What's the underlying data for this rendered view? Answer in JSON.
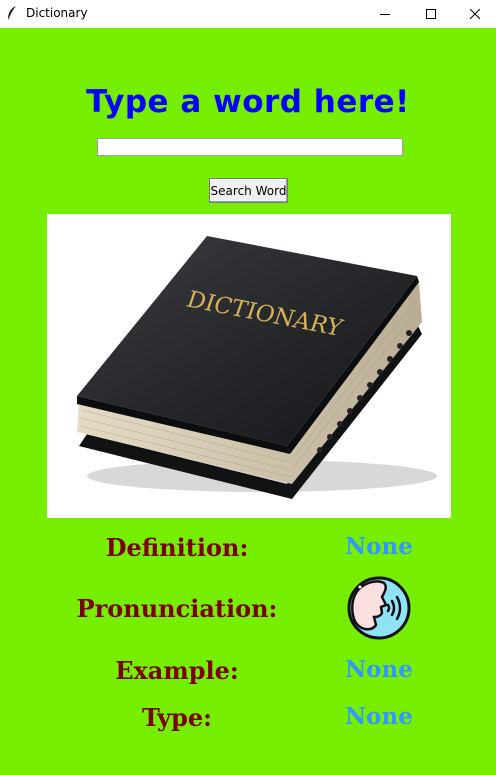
{
  "window": {
    "title": "Dictionary",
    "icon": "feather-icon"
  },
  "main": {
    "heading": "Type a word here!",
    "search": {
      "value": "",
      "placeholder": ""
    },
    "search_button_label": "Search Word"
  },
  "book": {
    "cover_text": "DICTIONARY"
  },
  "results": {
    "definition_label": "Definition:",
    "definition_value": "None",
    "pronunciation_label": "Pronunciation:",
    "pronunciation_icon": "speaking-head-icon",
    "example_label": "Example:",
    "example_value": "None",
    "type_label": "Type:",
    "type_value": "None"
  },
  "colors": {
    "background": "#76ee00",
    "heading": "#0000ff",
    "label": "#7a0000",
    "value": "#3399ff"
  }
}
